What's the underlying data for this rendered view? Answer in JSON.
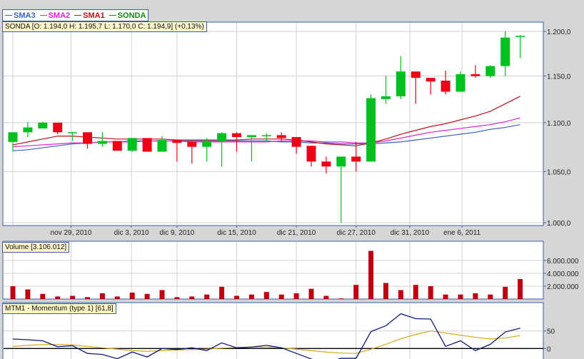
{
  "legend": [
    {
      "label": "SMA3",
      "color": "#3b62c4"
    },
    {
      "label": "SMA2",
      "color": "#e020d8"
    },
    {
      "label": "SMA1",
      "color": "#c0101a"
    },
    {
      "label": "SONDA",
      "color": "#138a13"
    }
  ],
  "main_info": "SONDA [O: 1.194,0  H: 1.195,7  L: 1.170,0  C: 1.194,9] (+0,13%)",
  "volume_info": "Volume [3.106.012]",
  "momentum_info": "MTM1 - Momentum (type 1) [61,8]",
  "colors": {
    "up": "#00c020",
    "down": "#ee0018",
    "volume": "#c00010",
    "momentum": "#0a1a80",
    "signal": "#d8a820"
  },
  "chart_data": [
    {
      "type": "candlestick",
      "title": "SONDA",
      "y_ticks": [
        "1.000,0",
        "1.050,0",
        "1.100,0",
        "1.150,0",
        "1.200,0"
      ],
      "y_tick_values": [
        1000,
        1050,
        1100,
        1150,
        1200
      ],
      "ylim": [
        1000,
        1200
      ],
      "scale": "log",
      "x_labels": [
        {
          "label": "nov 29, 2010",
          "index": 3.9
        },
        {
          "label": "dic 3, 2010",
          "index": 7.95
        },
        {
          "label": "dic 9, 2010",
          "index": 11
        },
        {
          "label": "dic 15, 2010",
          "index": 15
        },
        {
          "label": "dic 21, 2010",
          "index": 19
        },
        {
          "label": "dic 27, 2010",
          "index": 23
        },
        {
          "label": "dic 31, 2010",
          "index": 26.6
        },
        {
          "label": "ene 6, 2011",
          "index": 30.1
        }
      ],
      "ohlc": [
        [
          1080,
          1090,
          1070,
          1090
        ],
        [
          1090,
          1101,
          1085,
          1095
        ],
        [
          1094,
          1101,
          1094,
          1100
        ],
        [
          1100,
          1100,
          1088,
          1090
        ],
        [
          1090,
          1090,
          1081,
          1090
        ],
        [
          1090,
          1090,
          1073,
          1078
        ],
        [
          1078,
          1090,
          1075,
          1081
        ],
        [
          1081,
          1081,
          1071,
          1071
        ],
        [
          1071,
          1084,
          1070,
          1084
        ],
        [
          1084,
          1084,
          1070,
          1070
        ],
        [
          1070,
          1086,
          1070,
          1082
        ],
        [
          1082,
          1082,
          1060,
          1079
        ],
        [
          1080,
          1081,
          1058,
          1075
        ],
        [
          1075,
          1084,
          1060,
          1081
        ],
        [
          1081,
          1090,
          1055,
          1089
        ],
        [
          1089,
          1090,
          1070,
          1085
        ],
        [
          1085,
          1087,
          1060,
          1087
        ],
        [
          1087,
          1089,
          1080,
          1087
        ],
        [
          1087,
          1090,
          1080,
          1084
        ],
        [
          1085,
          1085,
          1068,
          1075
        ],
        [
          1076,
          1076,
          1055,
          1060
        ],
        [
          1060,
          1065,
          1048,
          1055
        ],
        [
          1055,
          1065,
          1000,
          1065
        ],
        [
          1065,
          1080,
          1050,
          1060
        ],
        [
          1060,
          1130,
          1060,
          1126
        ],
        [
          1125,
          1150,
          1120,
          1128
        ],
        [
          1128,
          1172,
          1125,
          1155
        ],
        [
          1155,
          1155,
          1120,
          1148
        ],
        [
          1148,
          1148,
          1130,
          1144
        ],
        [
          1145,
          1156,
          1130,
          1133
        ],
        [
          1133,
          1155,
          1133,
          1152
        ],
        [
          1152,
          1162,
          1148,
          1150
        ],
        [
          1150,
          1162,
          1148,
          1161
        ],
        [
          1161,
          1200,
          1150,
          1193
        ],
        [
          1194,
          1195.7,
          1170,
          1194.9
        ]
      ],
      "series": [
        {
          "name": "SMA1",
          "values": [
            1077,
            1080,
            1083,
            1086,
            1086,
            1085,
            1084,
            1083,
            1083,
            1083,
            1083,
            1082,
            1082,
            1082,
            1082,
            1082,
            1083,
            1083,
            1083,
            1082,
            1080,
            1078,
            1077,
            1076,
            1079,
            1083,
            1088,
            1092,
            1096,
            1099,
            1103,
            1107,
            1112,
            1120,
            1128
          ]
        },
        {
          "name": "SMA2",
          "values": [
            1075,
            1076,
            1077,
            1078,
            1079,
            1079,
            1080,
            1080,
            1080,
            1081,
            1081,
            1081,
            1080,
            1080,
            1080,
            1080,
            1080,
            1080,
            1081,
            1081,
            1081,
            1080,
            1080,
            1079,
            1079,
            1081,
            1084,
            1087,
            1090,
            1092,
            1094,
            1096,
            1098,
            1101,
            1105
          ]
        },
        {
          "name": "SMA3",
          "values": [
            1071,
            1072,
            1074,
            1076,
            1078,
            1079,
            1080,
            1080,
            1081,
            1081,
            1081,
            1081,
            1081,
            1081,
            1081,
            1081,
            1081,
            1081,
            1080,
            1080,
            1079,
            1079,
            1078,
            1078,
            1078,
            1079,
            1080,
            1082,
            1084,
            1086,
            1088,
            1090,
            1093,
            1095,
            1098
          ]
        }
      ]
    },
    {
      "type": "bar",
      "title": "Volume",
      "y_ticks": [
        "2.000.000",
        "4.000.000",
        "6.000.000"
      ],
      "y_tick_values": [
        2000000,
        4000000,
        6000000
      ],
      "values": [
        2000000,
        1500000,
        800000,
        400000,
        500000,
        300000,
        900000,
        400000,
        1000000,
        800000,
        1400000,
        300000,
        400000,
        700000,
        1900000,
        500000,
        700000,
        1100000,
        700000,
        900000,
        1600000,
        500000,
        100000,
        2200000,
        7500000,
        2500000,
        1400000,
        2200000,
        2000000,
        700000,
        700000,
        900000,
        700000,
        1900000,
        3106012
      ]
    },
    {
      "type": "line",
      "title": "MTM1 - Momentum (type 1)",
      "y_ticks": [
        "0",
        "50"
      ],
      "y_tick_values": [
        0,
        50
      ],
      "series": [
        {
          "name": "Momentum",
          "values": [
            27,
            25,
            22,
            5,
            8,
            -14,
            -17,
            -29,
            -10,
            -24,
            0,
            -3,
            2,
            -6,
            16,
            2,
            4,
            9,
            2,
            -14,
            -30,
            -40,
            -28,
            -28,
            48,
            65,
            99,
            85,
            84,
            6,
            22,
            -6,
            12,
            47,
            58
          ]
        },
        {
          "name": "Signal",
          "values": [
            6,
            9,
            11,
            11,
            10,
            6,
            2,
            -2,
            -6,
            -8,
            -6,
            -4,
            -3,
            -2,
            1,
            3,
            4,
            4,
            2,
            -2,
            -6,
            -10,
            -13,
            -14,
            -2,
            12,
            28,
            40,
            50,
            44,
            38,
            32,
            27,
            30,
            37
          ]
        }
      ]
    }
  ]
}
